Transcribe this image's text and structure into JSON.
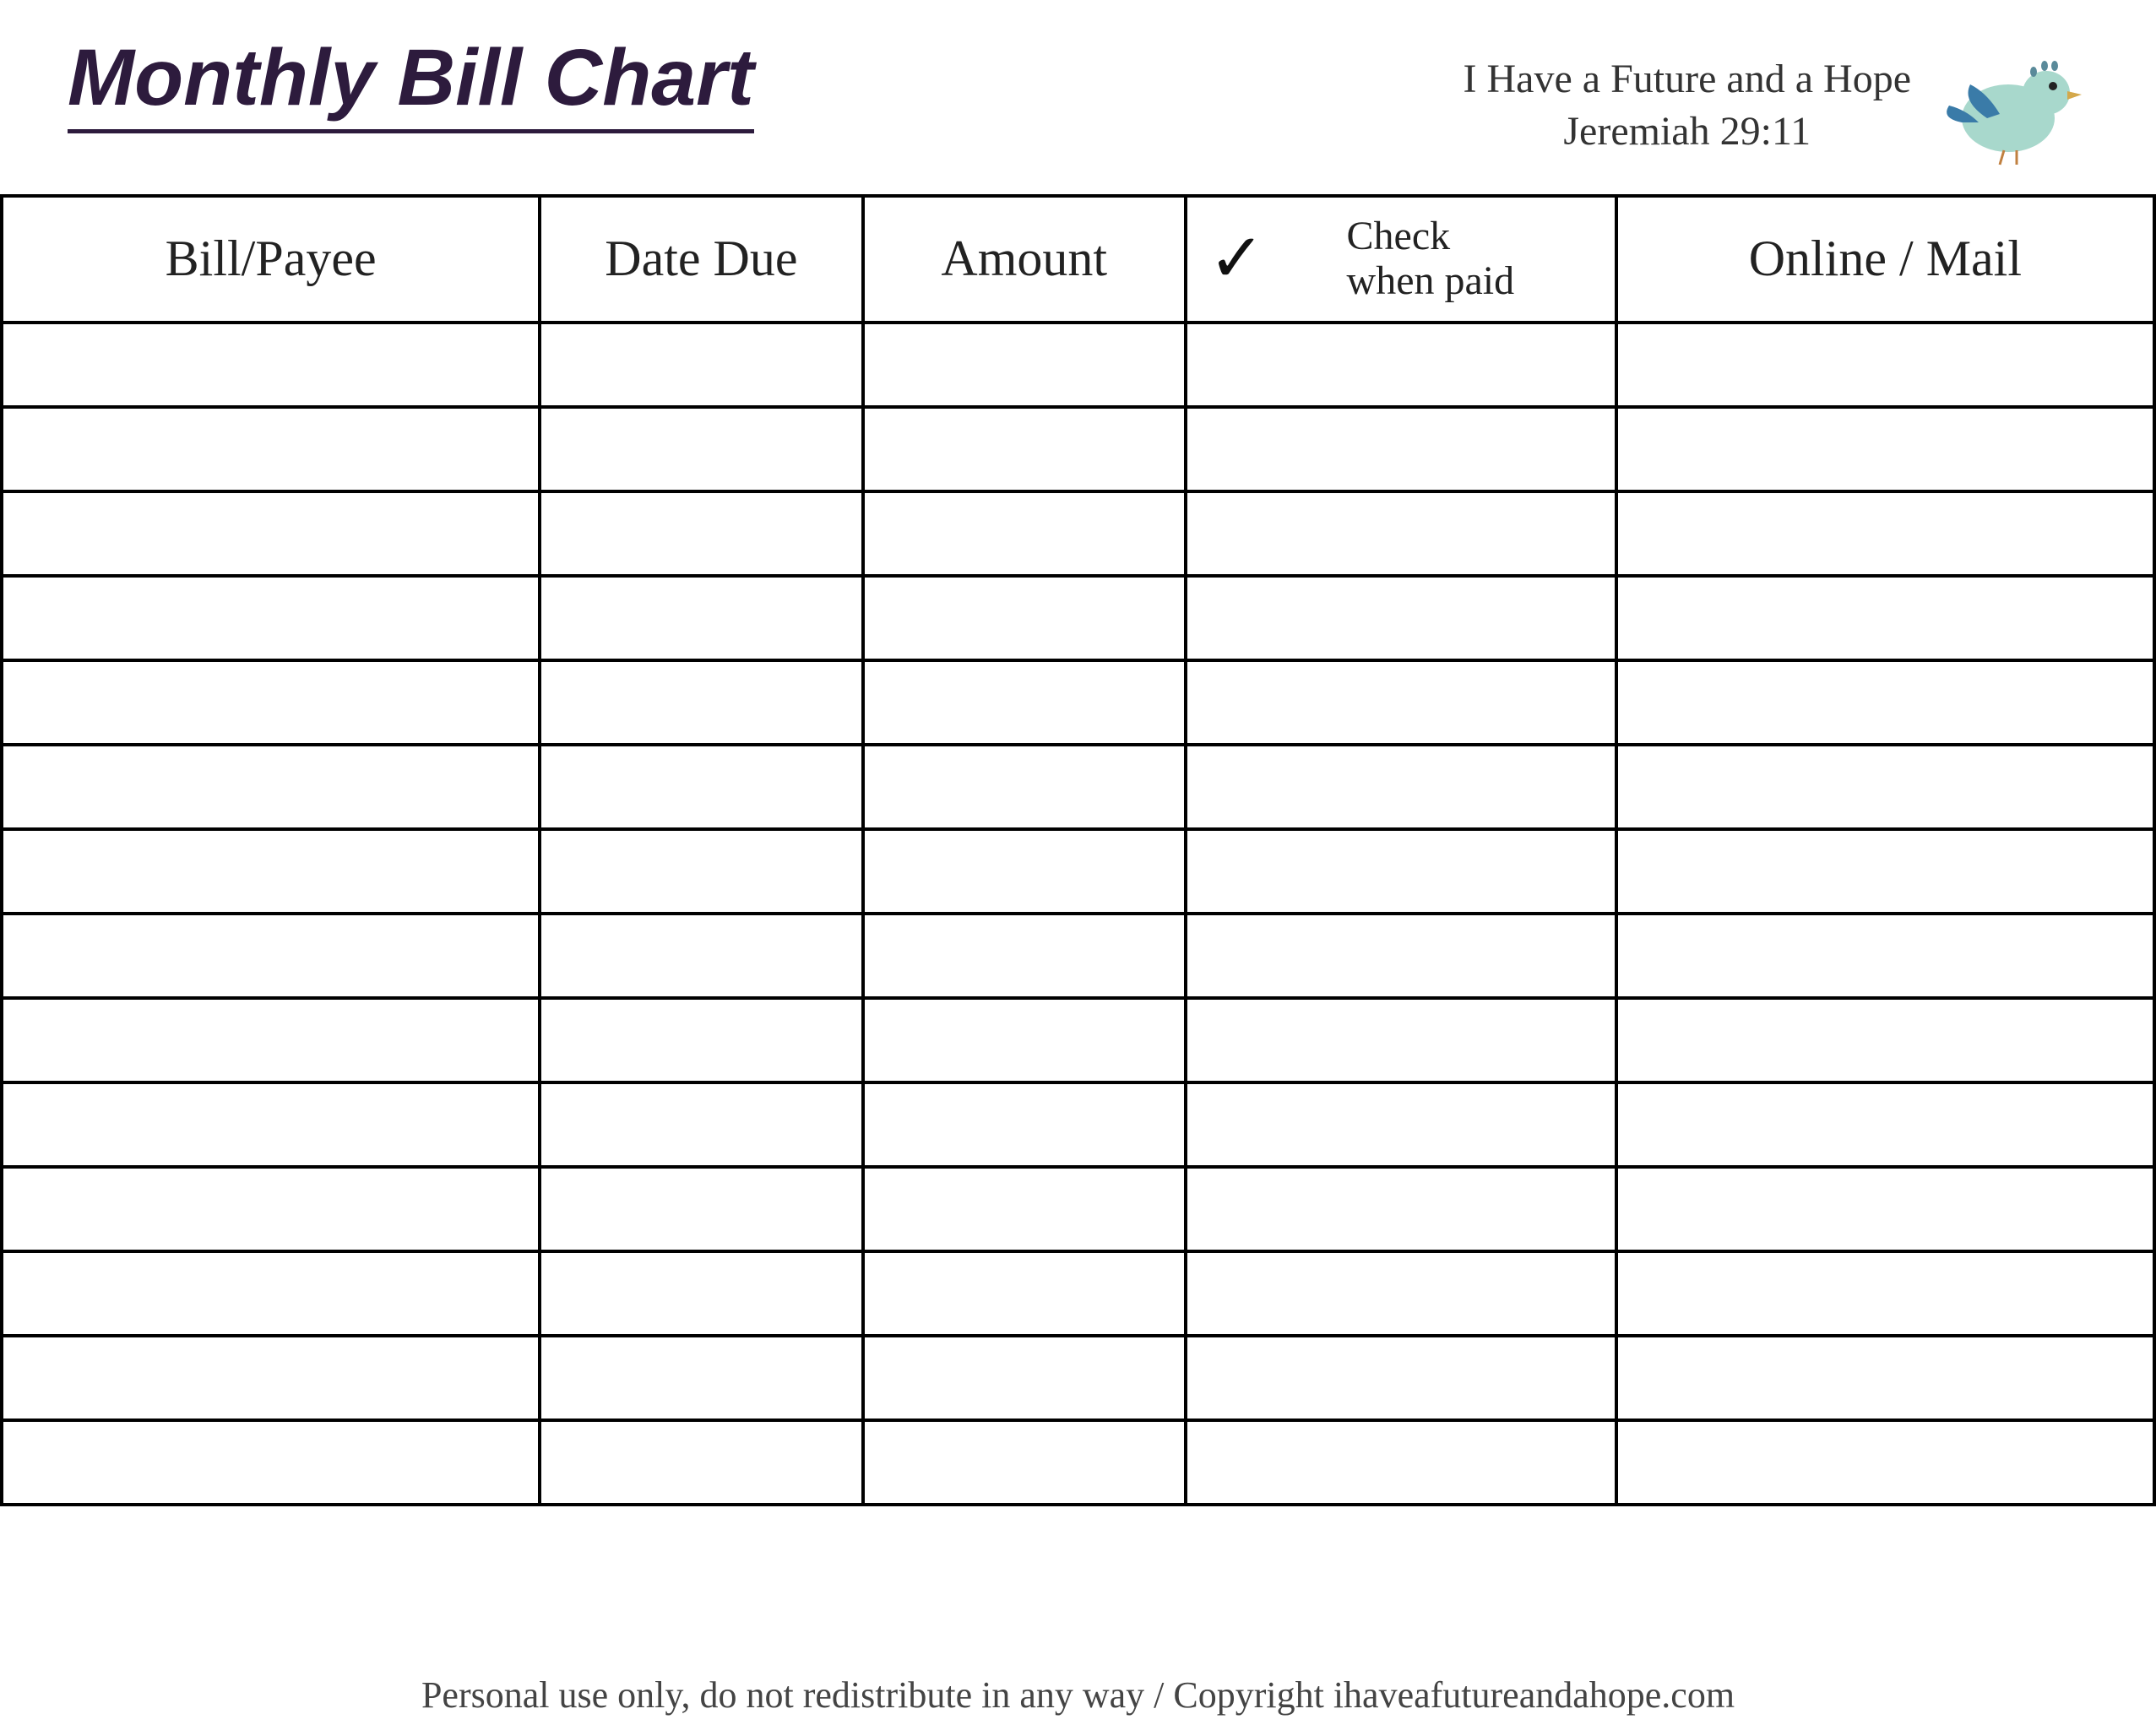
{
  "header": {
    "title": "Monthly Bill Chart",
    "verse_line1": "I Have a Future and a Hope",
    "verse_line2": "Jeremiah 29:11"
  },
  "columns": {
    "payee": "Bill/Payee",
    "date_due": "Date Due",
    "amount": "Amount",
    "check_paid": "Check\nwhen paid",
    "online_mail": "Online / Mail"
  },
  "rows": [
    {
      "payee": "",
      "date_due": "",
      "amount": "",
      "check_paid": "",
      "online_mail": ""
    },
    {
      "payee": "",
      "date_due": "",
      "amount": "",
      "check_paid": "",
      "online_mail": ""
    },
    {
      "payee": "",
      "date_due": "",
      "amount": "",
      "check_paid": "",
      "online_mail": ""
    },
    {
      "payee": "",
      "date_due": "",
      "amount": "",
      "check_paid": "",
      "online_mail": ""
    },
    {
      "payee": "",
      "date_due": "",
      "amount": "",
      "check_paid": "",
      "online_mail": ""
    },
    {
      "payee": "",
      "date_due": "",
      "amount": "",
      "check_paid": "",
      "online_mail": ""
    },
    {
      "payee": "",
      "date_due": "",
      "amount": "",
      "check_paid": "",
      "online_mail": ""
    },
    {
      "payee": "",
      "date_due": "",
      "amount": "",
      "check_paid": "",
      "online_mail": ""
    },
    {
      "payee": "",
      "date_due": "",
      "amount": "",
      "check_paid": "",
      "online_mail": ""
    },
    {
      "payee": "",
      "date_due": "",
      "amount": "",
      "check_paid": "",
      "online_mail": ""
    },
    {
      "payee": "",
      "date_due": "",
      "amount": "",
      "check_paid": "",
      "online_mail": ""
    },
    {
      "payee": "",
      "date_due": "",
      "amount": "",
      "check_paid": "",
      "online_mail": ""
    },
    {
      "payee": "",
      "date_due": "",
      "amount": "",
      "check_paid": "",
      "online_mail": ""
    },
    {
      "payee": "",
      "date_due": "",
      "amount": "",
      "check_paid": "",
      "online_mail": ""
    }
  ],
  "footer": "Personal use only, do not redistribute in any way / Copyright ihaveafutureandahope.com"
}
